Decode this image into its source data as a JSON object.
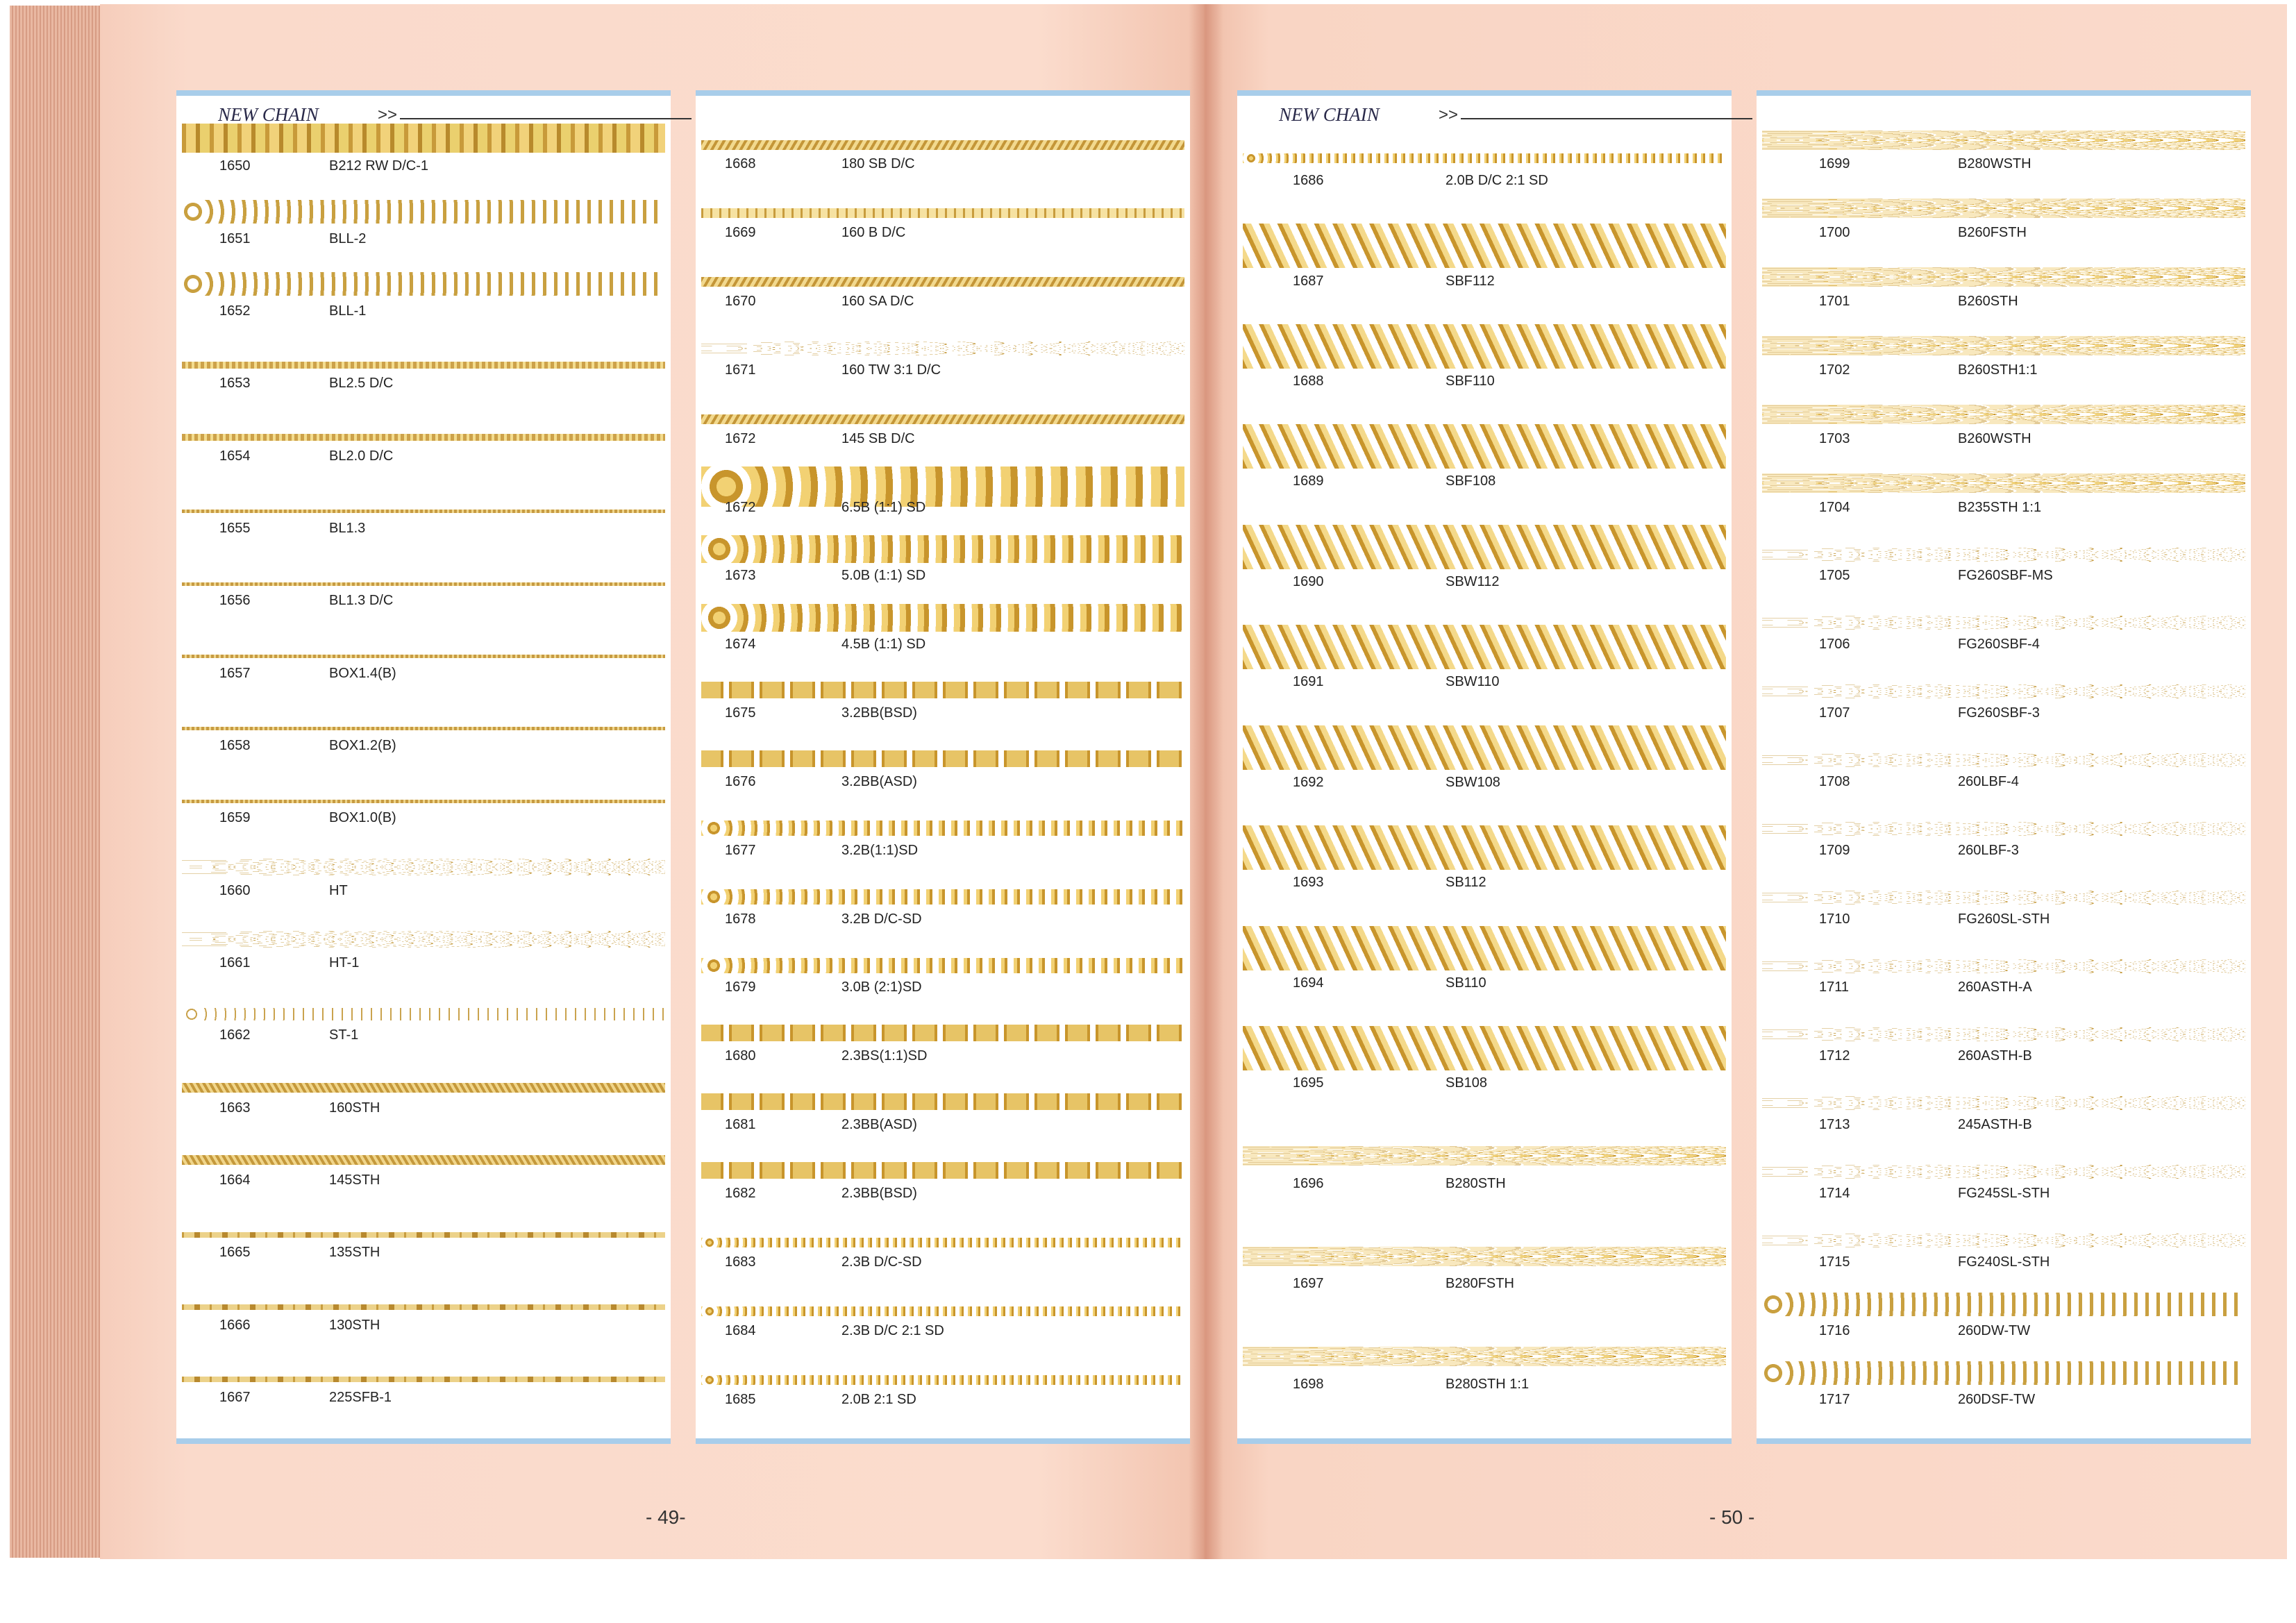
{
  "left_page": {
    "header_title": "NEW CHAIN",
    "header_arrow": ">>",
    "page_number": "- 49-",
    "col1": [
      {
        "code": "1650",
        "name": "B212 RW D/C-1",
        "style": "heavy"
      },
      {
        "code": "1651",
        "name": "BLL-2",
        "style": "rolo"
      },
      {
        "code": "1652",
        "name": "BLL-1",
        "style": "rolo"
      },
      {
        "code": "1653",
        "name": "BL2.5 D/C",
        "style": "fine"
      },
      {
        "code": "1654",
        "name": "BL2.0 D/C",
        "style": "fine"
      },
      {
        "code": "1655",
        "name": "BL1.3",
        "style": "thin"
      },
      {
        "code": "1656",
        "name": "BL1.3 D/C",
        "style": "thin"
      },
      {
        "code": "1657",
        "name": "BOX1.4(B)",
        "style": "thin"
      },
      {
        "code": "1658",
        "name": "BOX1.2(B)",
        "style": "thin"
      },
      {
        "code": "1659",
        "name": "BOX1.0(B)",
        "style": "thin"
      },
      {
        "code": "1660",
        "name": "HT",
        "style": "heart"
      },
      {
        "code": "1661",
        "name": "HT-1",
        "style": "heart"
      },
      {
        "code": "1662",
        "name": "ST-1",
        "style": "star"
      },
      {
        "code": "1663",
        "name": "160STH",
        "style": "rope"
      },
      {
        "code": "1664",
        "name": "145STH",
        "style": "rope"
      },
      {
        "code": "1665",
        "name": "135STH",
        "style": "station"
      },
      {
        "code": "1666",
        "name": "130STH",
        "style": "station"
      },
      {
        "code": "1667",
        "name": "225SFB-1",
        "style": "station"
      }
    ],
    "col2": [
      {
        "code": "1668",
        "name": "180 SB D/C",
        "style": "twist"
      },
      {
        "code": "1669",
        "name": "160 B D/C",
        "style": "box"
      },
      {
        "code": "1670",
        "name": "160 SA D/C",
        "style": "twist"
      },
      {
        "code": "1671",
        "name": "160 TW 3:1 D/C",
        "style": "link"
      },
      {
        "code": "1672",
        "name": "145 SB D/C",
        "style": "twist"
      },
      {
        "code": "1672",
        "name": "6.5B (1:1) SD",
        "style": "ballbig"
      },
      {
        "code": "1673",
        "name": "5.0B (1:1) SD",
        "style": "ballmid"
      },
      {
        "code": "1674",
        "name": "4.5B (1:1) SD",
        "style": "ballmid"
      },
      {
        "code": "1675",
        "name": "3.2BB(BSD)",
        "style": "bead"
      },
      {
        "code": "1676",
        "name": "3.2BB(ASD)",
        "style": "bead"
      },
      {
        "code": "1677",
        "name": "3.2B(1:1)SD",
        "style": "ballsmall"
      },
      {
        "code": "1678",
        "name": "3.2B D/C-SD",
        "style": "ballsmall"
      },
      {
        "code": "1679",
        "name": "3.0B (2:1)SD",
        "style": "ballsmall"
      },
      {
        "code": "1680",
        "name": "2.3BS(1:1)SD",
        "style": "bead"
      },
      {
        "code": "1681",
        "name": "2.3BB(ASD)",
        "style": "bead"
      },
      {
        "code": "1682",
        "name": "2.3BB(BSD)",
        "style": "bead"
      },
      {
        "code": "1683",
        "name": "2.3B D/C-SD",
        "style": "balltiny"
      },
      {
        "code": "1684",
        "name": "2.3B D/C 2:1 SD",
        "style": "balltiny"
      },
      {
        "code": "1685",
        "name": "2.0B 2:1 SD",
        "style": "balltiny"
      }
    ]
  },
  "right_page": {
    "header_title": "NEW CHAIN",
    "header_arrow": ">>",
    "page_number": "- 50 -",
    "col1": [
      {
        "code": "1686",
        "name": "2.0B D/C 2:1 SD",
        "style": "balltiny"
      },
      {
        "code": "1687",
        "name": "SBF112",
        "style": "fishbone"
      },
      {
        "code": "1688",
        "name": "SBF110",
        "style": "fishbone"
      },
      {
        "code": "1689",
        "name": "SBF108",
        "style": "fishbone"
      },
      {
        "code": "1690",
        "name": "SBW112",
        "style": "fishbone"
      },
      {
        "code": "1691",
        "name": "SBW110",
        "style": "fishbone"
      },
      {
        "code": "1692",
        "name": "SBW108",
        "style": "fishbone"
      },
      {
        "code": "1693",
        "name": "SB112",
        "style": "fishbone"
      },
      {
        "code": "1694",
        "name": "SB110",
        "style": "fishbone"
      },
      {
        "code": "1695",
        "name": "SB108",
        "style": "fishbone"
      },
      {
        "code": "1696",
        "name": "B280STH",
        "style": "mariner"
      },
      {
        "code": "1697",
        "name": "B280FSTH",
        "style": "mariner"
      },
      {
        "code": "1698",
        "name": "B280STH 1:1",
        "style": "mariner"
      }
    ],
    "col2": [
      {
        "code": "1699",
        "name": "B280WSTH",
        "style": "mariner"
      },
      {
        "code": "1700",
        "name": "B260FSTH",
        "style": "mariner"
      },
      {
        "code": "1701",
        "name": "B260STH",
        "style": "mariner"
      },
      {
        "code": "1702",
        "name": "B260STH1:1",
        "style": "mariner"
      },
      {
        "code": "1703",
        "name": "B260WSTH",
        "style": "mariner"
      },
      {
        "code": "1704",
        "name": "B235STH 1:1",
        "style": "mariner"
      },
      {
        "code": "1705",
        "name": "FG260SBF-MS",
        "style": "link"
      },
      {
        "code": "1706",
        "name": "FG260SBF-4",
        "style": "link"
      },
      {
        "code": "1707",
        "name": "FG260SBF-3",
        "style": "link"
      },
      {
        "code": "1708",
        "name": "260LBF-4",
        "style": "link"
      },
      {
        "code": "1709",
        "name": "260LBF-3",
        "style": "link"
      },
      {
        "code": "1710",
        "name": "FG260SL-STH",
        "style": "link"
      },
      {
        "code": "1711",
        "name": "260ASTH-A",
        "style": "link"
      },
      {
        "code": "1712",
        "name": "260ASTH-B",
        "style": "link"
      },
      {
        "code": "1713",
        "name": "245ASTH-B",
        "style": "link"
      },
      {
        "code": "1714",
        "name": "FG245SL-STH",
        "style": "link"
      },
      {
        "code": "1715",
        "name": "FG240SL-STH",
        "style": "link"
      },
      {
        "code": "1716",
        "name": "260DW-TW",
        "style": "rolo"
      },
      {
        "code": "1717",
        "name": "260DSF-TW",
        "style": "rolo"
      }
    ]
  }
}
